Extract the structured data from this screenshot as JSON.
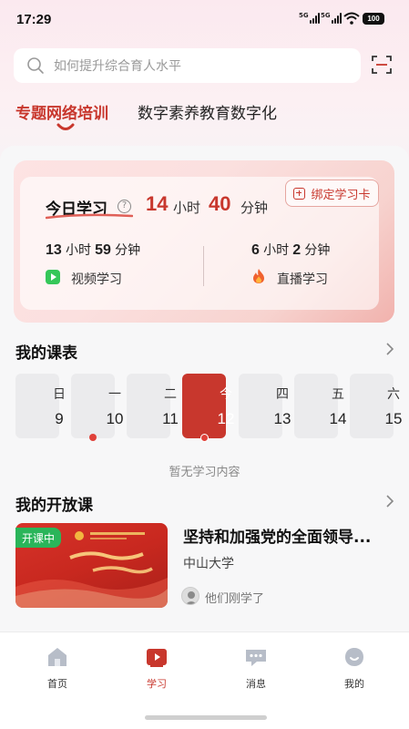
{
  "status_bar": {
    "time": "17:29",
    "signal1": "5G",
    "signal2": "5G",
    "battery": "100"
  },
  "search": {
    "placeholder": "如何提升综合育人水平"
  },
  "tabs": [
    {
      "label": "专题网络培训",
      "active": true
    },
    {
      "label": "数字素养教育数字化",
      "active": false
    }
  ],
  "study_card": {
    "today_label": "今日学习",
    "hours": "14",
    "hours_unit": "小时",
    "minutes": "40",
    "minutes_unit": "分钟",
    "bind_button": "绑定学习卡",
    "video": {
      "hours": "13",
      "minutes": "59",
      "hours_unit": "小时",
      "minutes_unit": "分钟",
      "label": "视频学习"
    },
    "live": {
      "hours": "6",
      "minutes": "2",
      "hours_unit": "小时",
      "minutes_unit": "分钟",
      "label": "直播学习"
    }
  },
  "schedule": {
    "title": "我的课表",
    "days": [
      {
        "weekday": "日",
        "date": "9",
        "today": false,
        "dot": false
      },
      {
        "weekday": "一",
        "date": "10",
        "today": false,
        "dot": true
      },
      {
        "weekday": "二",
        "date": "11",
        "today": false,
        "dot": false
      },
      {
        "weekday": "今",
        "date": "12",
        "today": true,
        "dot": true
      },
      {
        "weekday": "四",
        "date": "13",
        "today": false,
        "dot": false
      },
      {
        "weekday": "五",
        "date": "14",
        "today": false,
        "dot": false
      },
      {
        "weekday": "六",
        "date": "15",
        "today": false,
        "dot": false
      }
    ],
    "empty_note": "暂无学习内容"
  },
  "open_course": {
    "title": "我的开放课",
    "course": {
      "badge": "开课中",
      "name": "坚持和加强党的全面领导...",
      "org": "中山大学",
      "learners": "他们刚学了"
    }
  },
  "bottom_nav": [
    {
      "label": "首页",
      "icon": "home-icon",
      "active": false
    },
    {
      "label": "学习",
      "icon": "study-icon",
      "active": true
    },
    {
      "label": "消息",
      "icon": "message-icon",
      "active": false
    },
    {
      "label": "我的",
      "icon": "profile-icon",
      "active": false
    }
  ],
  "colors": {
    "accent": "#c8372d",
    "green": "#2ab55a",
    "background": "#f7f7f8"
  }
}
